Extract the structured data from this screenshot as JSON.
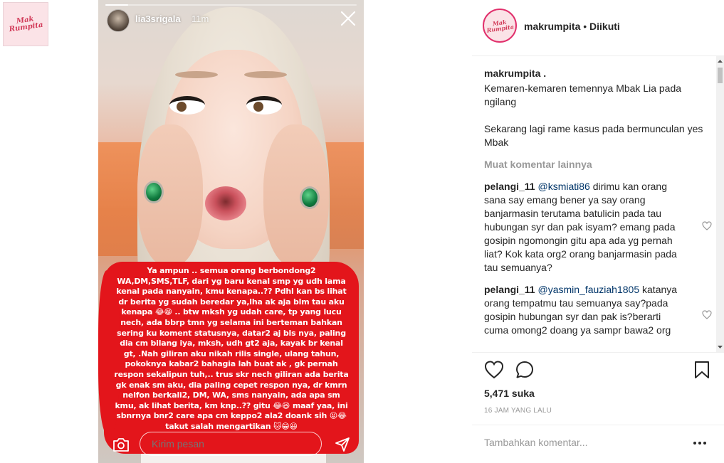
{
  "left_logo": {
    "text_line1": "Mak",
    "text_line2": "Rumpita"
  },
  "story": {
    "username": "lia3srigala",
    "time": "11m",
    "progress": 0.09,
    "red_text": "Ya ampun .. semua orang berbondong2 WA,DM,SMS,TLF, dari yg baru kenal smp yg udh lama kenal pada nanyain, kmu kenapa..?? Pdhl kan bs lihat dr berita yg sudah beredar ya,lha ak aja blm tau aku kenapa 😂😁 .. btw mksh yg udah care, tp yang lucu nech, ada bbrp tmn yg selama ini berteman bahkan sering ku koment statusnya, datar2 aj bls nya, paling dia cm bilang iya, mksh, udh gt2 aja, kayak br kenal gt, .Nah giliran aku nikah rilis single, ulang tahun, pokoknya kabar2 bahagia lah buat ak , gk pernah respon sekalipun tuh,.. trus skr nech giliran ada berita gk enak sm aku, dia paling cepet respon nya, dr kmrn nelfon berkali2, DM, WA, sms nanyain, ada apa sm kmu, ak lihat berita, km knp..?? gitu 😂😆 maaf yaa, ini sbnrnya bnr2 care apa cm keppo2 ala2 doank sih 😝😂 takut salah mengartikan 🐱😁😆",
    "reply_placeholder": "Kirim pesan"
  },
  "post": {
    "header": {
      "username": "makrumpita",
      "separator": " • ",
      "follow": "Diikuti",
      "avatar_line1": "Mak",
      "avatar_line2": "Rumpita"
    },
    "caption": {
      "username": "makrumpita .",
      "text": "Kemaren-kemaren temennya Mbak Lia pada ngilang\n\nSekarang lagi rame kasus pada bermunculan yes Mbak"
    },
    "load_more": "Muat komentar lainnya",
    "comments": [
      {
        "username": "pelangi_11",
        "mention": "@ksmiati86",
        "text": " dirimu kan orang sana say emang bener ya say orang banjarmasin terutama batulicin pada tau hubungan syr dan pak isyam? emang pada gosipin ngomongin gitu apa ada yg pernah liat? Kok kata org2 orang banjarmasin pada tau semuanya?"
      },
      {
        "username": "pelangi_11",
        "mention": "@yasmin_fauziah1805",
        "text": " katanya orang tempatmu tau semuanya say?pada gosipin hubungan syr dan pak is?berarti cuma omong2 doang ya sampr bawa2 org"
      }
    ],
    "likes": "5,471 suka",
    "time_ago": "16 JAM YANG LALU",
    "add_comment_placeholder": "Tambahkan komentar..."
  },
  "colors": {
    "accent_red": "#e3151b",
    "mention": "#003569",
    "muted": "#999999"
  }
}
